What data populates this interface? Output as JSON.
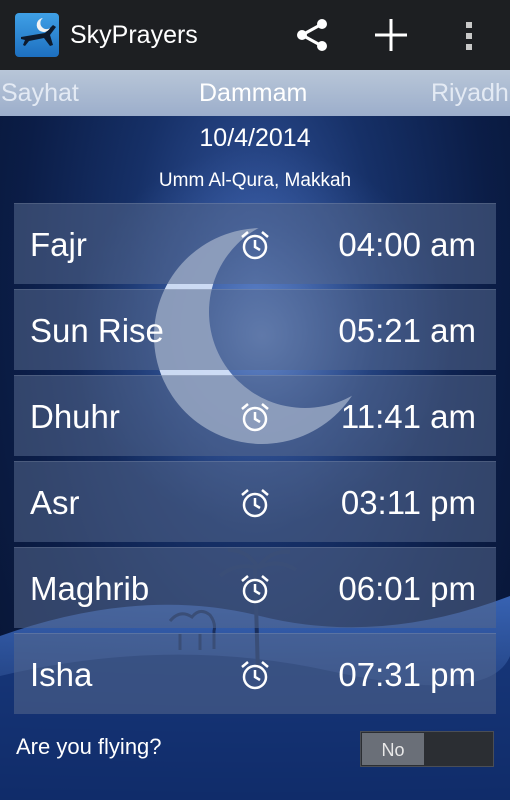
{
  "app": {
    "title": "SkyPrayers",
    "icon": "airplane-moon-icon"
  },
  "toolbar": {
    "share_icon": "share-icon",
    "add_icon": "add-icon",
    "menu_icon": "overflow-menu-icon"
  },
  "cities": {
    "previous": "Sayhat",
    "current": "Dammam",
    "next": "Riyadh"
  },
  "date": "10/4/2014",
  "method": "Umm Al-Qura, Makkah",
  "prayers": [
    {
      "name": "Fajr",
      "time": "04:00 am",
      "alarm": true
    },
    {
      "name": "Sun Rise",
      "time": "05:21 am",
      "alarm": false
    },
    {
      "name": "Dhuhr",
      "time": "11:41 am",
      "alarm": true
    },
    {
      "name": "Asr",
      "time": "03:11 pm",
      "alarm": true
    },
    {
      "name": "Maghrib",
      "time": "06:01 pm",
      "alarm": true
    },
    {
      "name": "Isha",
      "time": "07:31 pm",
      "alarm": true
    }
  ],
  "flying": {
    "label": "Are you flying?",
    "value": "No"
  },
  "colors": {
    "actionbar": "#1d1f22",
    "background": "#163067",
    "row": "#56688c"
  }
}
